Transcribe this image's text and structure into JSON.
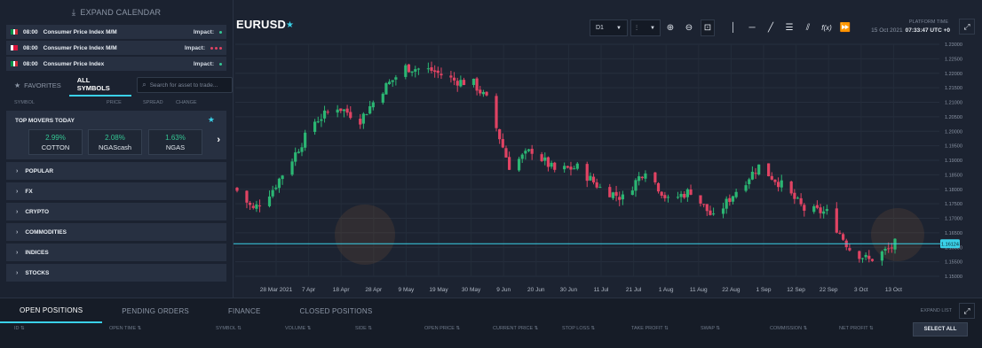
{
  "calendar": {
    "expand_label": "EXPAND CALENDAR",
    "events": [
      {
        "time": "08:00",
        "name": "Consumer Price Index M/M",
        "impact_label": "Impact:",
        "impact_level": 1,
        "flag_colors": [
          "#009246",
          "#ffffff",
          "#ce2b37"
        ]
      },
      {
        "time": "08:00",
        "name": "Consumer Price Index M/M",
        "impact_label": "Impact:",
        "impact_level": 3,
        "flag_colors": [
          "#ffffff",
          "#dc143c",
          "#dc143c"
        ]
      },
      {
        "time": "08:00",
        "name": "Consumer Price Index",
        "impact_label": "Impact:",
        "impact_level": 1,
        "flag_colors": [
          "#009246",
          "#ffffff",
          "#ce2b37"
        ]
      }
    ]
  },
  "symbols_panel": {
    "tab_favorites": "FAVORITES",
    "tab_all": "ALL SYMBOLS",
    "search_placeholder": "Search for asset to trade...",
    "columns": [
      "SYMBOL",
      "PRICE",
      "SPREAD",
      "CHANGE"
    ],
    "top_movers_title": "TOP MOVERS TODAY",
    "movers": [
      {
        "pct": "2.99%",
        "name": "COTTON"
      },
      {
        "pct": "2.08%",
        "name": "NGAScash"
      },
      {
        "pct": "1.63%",
        "name": "NGAS"
      }
    ],
    "categories": [
      "POPULAR",
      "FX",
      "CRYPTO",
      "COMMODITIES",
      "INDICES",
      "STOCKS"
    ]
  },
  "chart_header": {
    "symbol": "EURUSD",
    "timeframe": "D1",
    "platform_time_label": "PLATFORM TIME",
    "platform_date": "15 Oct 2021",
    "platform_clock": "07:33:47 UTC +0"
  },
  "chart_data": {
    "type": "candlestick",
    "title": "",
    "x_ticks": [
      "28 Mar 2021",
      "7 Apr",
      "18 Apr",
      "28 Apr",
      "9 May",
      "19 May",
      "30 May",
      "9 Jun",
      "20 Jun",
      "30 Jun",
      "11 Jul",
      "21 Jul",
      "1 Aug",
      "11 Aug",
      "22 Aug",
      "1 Sep",
      "12 Sep",
      "22 Sep",
      "3 Oct",
      "13 Oct"
    ],
    "y_ticks": [
      "1.23000",
      "1.22500",
      "1.22000",
      "1.21500",
      "1.21000",
      "1.20500",
      "1.20000",
      "1.19500",
      "1.19000",
      "1.18500",
      "1.18000",
      "1.17500",
      "1.17000",
      "1.16500",
      "1.16000",
      "1.15500",
      "1.15000"
    ],
    "ylim": [
      1.15,
      1.23
    ],
    "current_price": "1.16124",
    "up_color": "#2bb673",
    "down_color": "#e04363",
    "price_line_color": "#3ad1e8",
    "close_path": [
      [
        "26 Mar 2021",
        1.1795
      ],
      [
        "31 Mar 2021",
        1.173
      ],
      [
        "6 Apr 2021",
        1.18
      ],
      [
        "12 Apr 2021",
        1.1905
      ],
      [
        "19 Apr 2021",
        1.2035
      ],
      [
        "26 Apr 2021",
        1.2085
      ],
      [
        "3 May 2021",
        1.204
      ],
      [
        "10 May 2021",
        1.2145
      ],
      [
        "17 May 2021",
        1.222
      ],
      [
        "25 May 2021",
        1.221
      ],
      [
        "1 Jun 2021",
        1.2175
      ],
      [
        "7 Jun 2021",
        1.2165
      ],
      [
        "11 Jun 2021",
        1.211
      ],
      [
        "18 Jun 2021",
        1.188
      ],
      [
        "25 Jun 2021",
        1.1935
      ],
      [
        "2 Jul 2021",
        1.1865
      ],
      [
        "9 Jul 2021",
        1.1875
      ],
      [
        "16 Jul 2021",
        1.1805
      ],
      [
        "23 Jul 2021",
        1.177
      ],
      [
        "30 Jul 2021",
        1.187
      ],
      [
        "6 Aug 2021",
        1.176
      ],
      [
        "13 Aug 2021",
        1.1795
      ],
      [
        "20 Aug 2021",
        1.17
      ],
      [
        "27 Aug 2021",
        1.1795
      ],
      [
        "3 Sep 2021",
        1.188
      ],
      [
        "10 Sep 2021",
        1.1815
      ],
      [
        "17 Sep 2021",
        1.173
      ],
      [
        "24 Sep 2021",
        1.172
      ],
      [
        "1 Oct 2021",
        1.1595
      ],
      [
        "7 Oct 2021",
        1.1555
      ],
      [
        "14 Oct 2021",
        1.16
      ],
      [
        "15 Oct 2021",
        1.16124
      ]
    ],
    "grid": true
  },
  "bottom": {
    "tabs": [
      "OPEN POSITIONS",
      "PENDING ORDERS",
      "FINANCE",
      "CLOSED POSITIONS"
    ],
    "expand_list": "EXPAND LIST",
    "columns": [
      "ID",
      "OPEN TIME",
      "SYMBOL",
      "VOLUME",
      "SIDE",
      "OPEN PRICE",
      "CURRENT PRICE",
      "STOP LOSS",
      "TAKE PROFIT",
      "SWAP",
      "COMMISSION",
      "NET PROFIT"
    ],
    "select_all": "SELECT ALL"
  },
  "icons": [
    "chevron-down-icon",
    "star-icon",
    "search-icon",
    "chevron-right-icon",
    "zoom-in-icon",
    "zoom-out-icon",
    "zoom-reset-icon",
    "vertical-line-icon",
    "horizontal-line-icon",
    "trend-line-icon",
    "channel-icon",
    "parallel-lines-icon",
    "indicator-icon",
    "forward-icon",
    "fullscreen-icon"
  ]
}
